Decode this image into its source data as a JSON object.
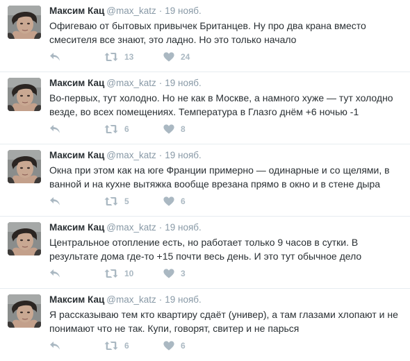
{
  "colors": {
    "name": "#292f33",
    "meta": "#8899a6",
    "icon": "#aab8c2",
    "divider": "#e6ecf0"
  },
  "tweets": [
    {
      "name": "Максим Кац",
      "handle": "@max_katz",
      "separator": "·",
      "time": "19 нояб.",
      "text": "Офигеваю от бытовых привычек Британцев. Ну про два крана вместо смесителя все знают, это ладно. Но это только начало",
      "retweets": "13",
      "likes": "24",
      "icons": {
        "reply": "reply-icon",
        "retweet": "retweet-icon",
        "like": "heart-icon"
      }
    },
    {
      "name": "Максим Кац",
      "handle": "@max_katz",
      "separator": "·",
      "time": "19 нояб.",
      "text": "Во-первых, тут холодно. Но не как в Москве, а намного хуже — тут холодно везде, во всех помещениях. Температура в Глазго днём +6 ночью -1",
      "retweets": "6",
      "likes": "8",
      "icons": {
        "reply": "reply-icon",
        "retweet": "retweet-icon",
        "like": "heart-icon"
      }
    },
    {
      "name": "Максим Кац",
      "handle": "@max_katz",
      "separator": "·",
      "time": "19 нояб.",
      "text": "Окна при этом как на юге Франции примерно — одинарные и со щелями, в ванной и на кухне вытяжка вообще врезана прямо в окно и в стене дыра",
      "retweets": "5",
      "likes": "6",
      "icons": {
        "reply": "reply-icon",
        "retweet": "retweet-icon",
        "like": "heart-icon"
      }
    },
    {
      "name": "Максим Кац",
      "handle": "@max_katz",
      "separator": "·",
      "time": "19 нояб.",
      "text": "Центральное отопление есть, но работает только 9 часов в сутки. В результате дома где-то +15 почти весь день. И это тут обычное дело",
      "retweets": "10",
      "likes": "3",
      "icons": {
        "reply": "reply-icon",
        "retweet": "retweet-icon",
        "like": "heart-icon"
      }
    },
    {
      "name": "Максим Кац",
      "handle": "@max_katz",
      "separator": "·",
      "time": "19 нояб.",
      "text": "Я рассказываю тем кто квартиру сдаёт (универ), а там глазами хлопают и не понимают что не так. Купи, говорят, свитер и не парься",
      "retweets": "6",
      "likes": "6",
      "icons": {
        "reply": "reply-icon",
        "retweet": "retweet-icon",
        "like": "heart-icon"
      }
    }
  ]
}
